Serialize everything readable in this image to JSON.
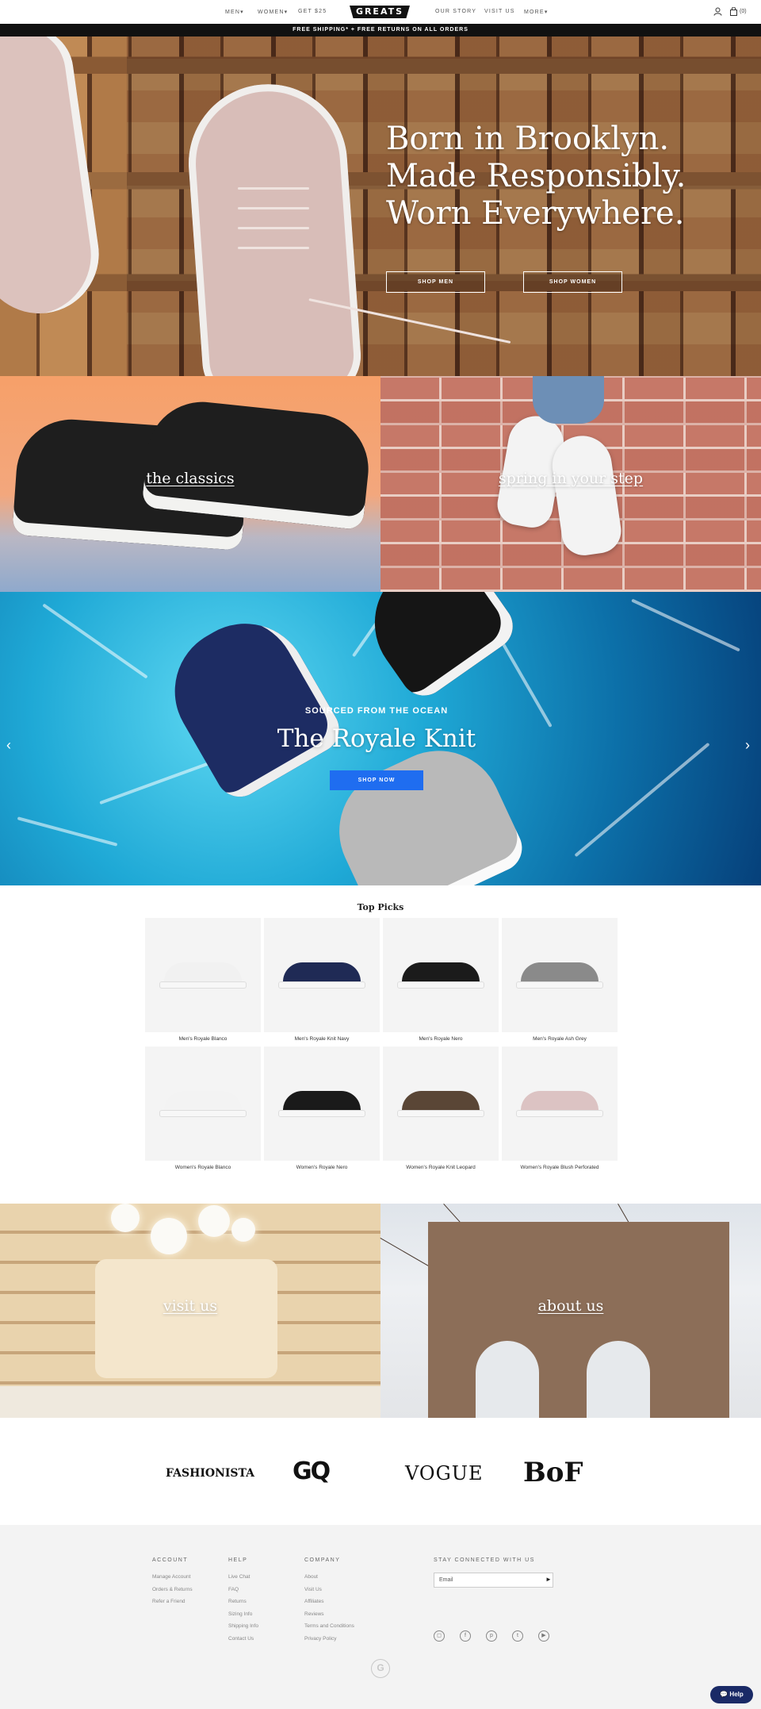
{
  "nav": {
    "left_items": [
      {
        "label": "MEN",
        "caret": "▾"
      },
      {
        "label": "WOMEN",
        "caret": "▾"
      },
      {
        "label": "GET $25",
        "caret": ""
      }
    ],
    "logo": "GREATS",
    "right_items": [
      {
        "label": "OUR STORY",
        "caret": ""
      },
      {
        "label": "VISIT US",
        "caret": ""
      },
      {
        "label": "MORE",
        "caret": "▾"
      }
    ],
    "cart_count": "(0)"
  },
  "promo_bar": "FREE SHIPPING* + FREE RETURNS ON ALL ORDERS",
  "hero": {
    "headline": [
      "Born in Brooklyn.",
      "Made Responsibly.",
      "Worn Everywhere."
    ],
    "shop_men": "SHOP MEN",
    "shop_women": "SHOP WOMEN"
  },
  "tiles": {
    "classics": "the classics",
    "spring": "spring in your step"
  },
  "ocean": {
    "kicker": "SOURCED FROM THE OCEAN",
    "title": "The Royale Knit",
    "cta": "SHOP NOW",
    "prev": "‹",
    "next": "›"
  },
  "top_picks": {
    "title": "Top Picks",
    "products": [
      {
        "name": "Men's Royale Blanco",
        "color": "#f1f1f1"
      },
      {
        "name": "Men's Royale Knit Navy",
        "color": "#1f2a55"
      },
      {
        "name": "Men's Royale Nero",
        "color": "#1b1b1b"
      },
      {
        "name": "Men's Royale Ash Grey",
        "color": "#8a8a8a"
      },
      {
        "name": "Women's Royale Blanco",
        "color": "#f3f3f3"
      },
      {
        "name": "Women's Royale Nero",
        "color": "#1a1a1a"
      },
      {
        "name": "Women's Royale Knit Leopard",
        "color": "#5a4636"
      },
      {
        "name": "Women's Royale Blush Perforated",
        "color": "#dcc3c3"
      }
    ]
  },
  "bottom_tiles": {
    "visit": "visit us",
    "about": "about us"
  },
  "press": [
    "FASHIONISTA",
    "GQ",
    "VOGUE",
    "BoF"
  ],
  "footer": {
    "account": {
      "heading": "ACCOUNT",
      "links": [
        "Manage Account",
        "Orders & Returns",
        "Refer a Friend"
      ]
    },
    "help": {
      "heading": "HELP",
      "links": [
        "Live Chat",
        "FAQ",
        "Returns",
        "Sizing Info",
        "Shipping Info",
        "Contact Us"
      ]
    },
    "company": {
      "heading": "COMPANY",
      "links": [
        "About",
        "Visit Us",
        "Affiliates",
        "Reviews",
        "Terms and Conditions",
        "Privacy Policy"
      ]
    },
    "connect": {
      "heading": "STAY CONNECTED WITH US",
      "email_placeholder": "Email"
    },
    "social_icons": [
      "instagram-icon",
      "facebook-icon",
      "pinterest-icon",
      "twitter-icon",
      "youtube-icon"
    ],
    "help_button": "Help"
  },
  "colors": {
    "accent_blue": "#1f6df0",
    "help_navy": "#1a2a66",
    "promo_bg": "#111111"
  }
}
